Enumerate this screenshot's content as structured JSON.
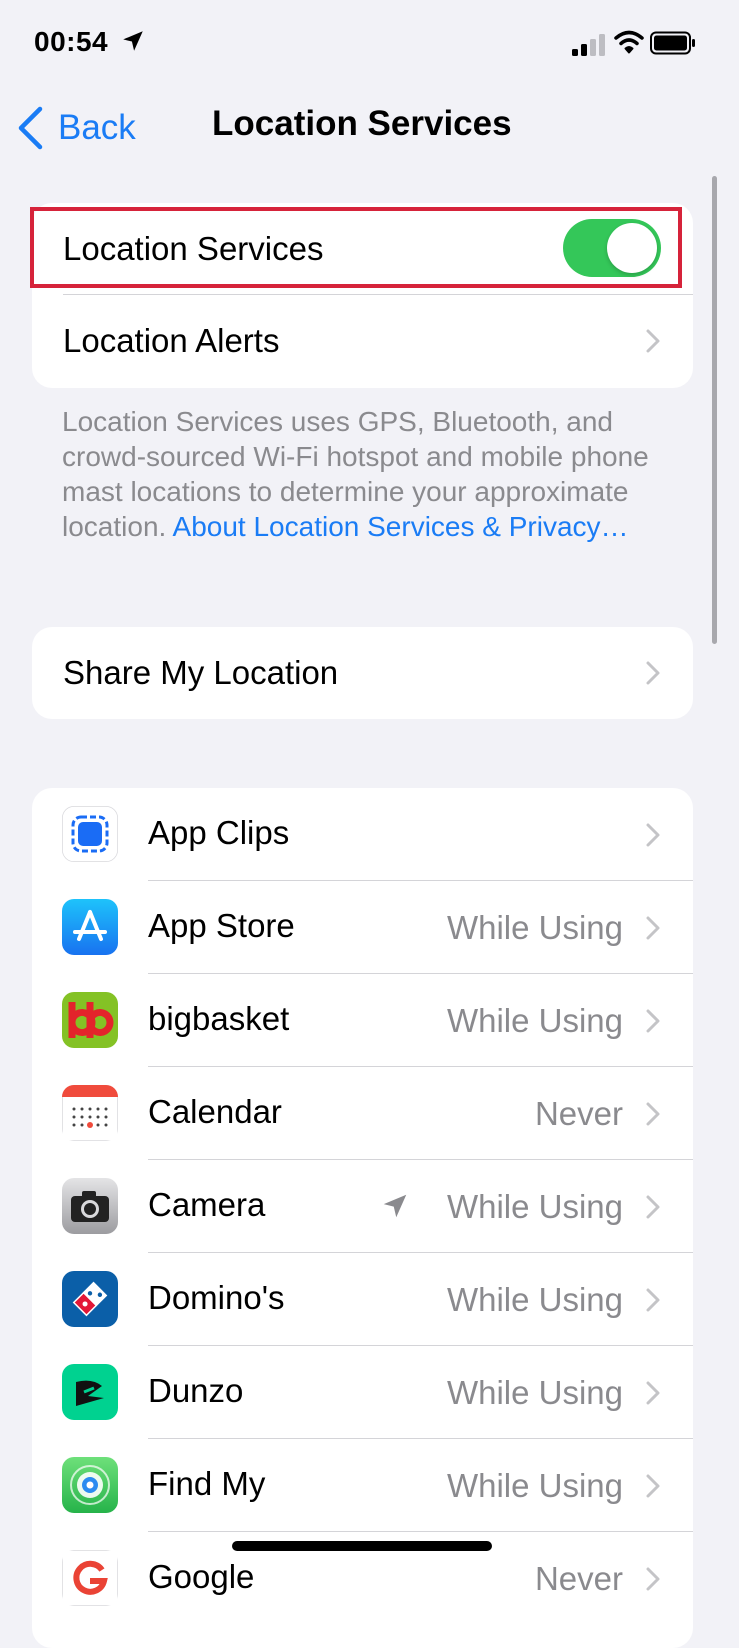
{
  "status_bar": {
    "time": "00:54"
  },
  "nav": {
    "back_label": "Back",
    "title": "Location Services"
  },
  "main_toggle": {
    "label": "Location Services",
    "on": true
  },
  "location_alerts": {
    "label": "Location Alerts"
  },
  "footnote": {
    "text": "Location Services uses GPS, Bluetooth, and crowd-sourced Wi-Fi hotspot and mobile phone mast locations to determine your approximate location.",
    "link": "About Location Services & Privacy…"
  },
  "share_location": {
    "label": "Share My Location"
  },
  "apps": [
    {
      "name": "App Clips",
      "value": "",
      "icon": "app-clips-icon"
    },
    {
      "name": "App Store",
      "value": "While Using",
      "icon": "app-store-icon"
    },
    {
      "name": "bigbasket",
      "value": "While Using",
      "icon": "bigbasket-icon"
    },
    {
      "name": "Calendar",
      "value": "Never",
      "icon": "calendar-icon"
    },
    {
      "name": "Camera",
      "value": "While Using",
      "icon": "camera-icon",
      "recent_use_icon": "location-arrow-icon"
    },
    {
      "name": "Domino's",
      "value": "While Using",
      "icon": "dominos-icon"
    },
    {
      "name": "Dunzo",
      "value": "While Using",
      "icon": "dunzo-icon"
    },
    {
      "name": "Find My",
      "value": "While Using",
      "icon": "find-my-icon"
    },
    {
      "name": "Google",
      "value": "Never",
      "icon": "google-icon"
    }
  ],
  "colors": {
    "accent": "#1a7cf5",
    "toggle_on": "#34c759",
    "highlight": "#d6233a",
    "background": "#f2f2f7",
    "secondary_text": "#8a8a8e"
  }
}
